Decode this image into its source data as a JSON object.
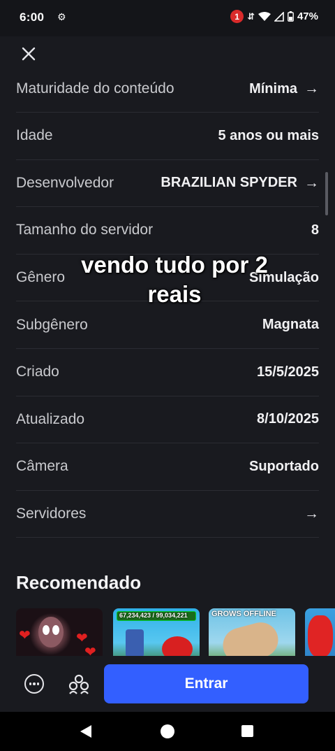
{
  "status_bar": {
    "time": "6:00",
    "notification_count": "1",
    "battery": "47%"
  },
  "details": [
    {
      "label": "Maturidade do conteúdo",
      "value": "Mínima",
      "has_arrow": true
    },
    {
      "label": "Idade",
      "value": "5 anos ou mais",
      "has_arrow": false
    },
    {
      "label": "Desenvolvedor",
      "value": "BRAZILIAN SPYDER",
      "has_arrow": true
    },
    {
      "label": "Tamanho do servidor",
      "value": "8",
      "has_arrow": false
    },
    {
      "label": "Gênero",
      "value": "Simulação",
      "has_arrow": false
    },
    {
      "label": "Subgênero",
      "value": "Magnata",
      "has_arrow": false
    },
    {
      "label": "Criado",
      "value": "15/5/2025",
      "has_arrow": false
    },
    {
      "label": "Atualizado",
      "value": "8/10/2025",
      "has_arrow": false
    },
    {
      "label": "Câmera",
      "value": "Suportado",
      "has_arrow": false
    },
    {
      "label": "Servidores",
      "value": "",
      "has_arrow": true
    }
  ],
  "overlay_caption": {
    "line1": "vendo tudo por 2",
    "line2": "reais"
  },
  "recommended": {
    "title": "Recomendado",
    "cards": [
      {
        "label": ""
      },
      {
        "label": "67,234,423 / 99,034,221"
      },
      {
        "label": "GROWS OFFLINE"
      },
      {
        "label": ""
      }
    ]
  },
  "bottom_bar": {
    "play_label": "Entrar"
  },
  "icons": {
    "close": "close-icon",
    "arrow": "arrow-right-icon",
    "more": "more-options-icon",
    "friends": "friends-icon"
  },
  "colors": {
    "background": "#191a1f",
    "play_button": "#335fff",
    "badge": "#d92b2b"
  }
}
